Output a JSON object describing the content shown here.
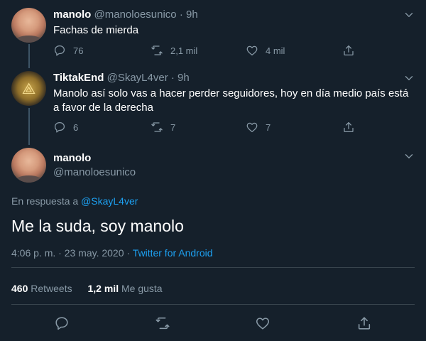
{
  "tweets": [
    {
      "name": "manolo",
      "handle": "@manoloesunico",
      "separator": "·",
      "time": "9h",
      "text": "Fachas de mierda",
      "replies": "76",
      "retweets": "2,1 mil",
      "likes": "4 mil"
    },
    {
      "name": "TiktakEnd",
      "handle": "@SkayL4ver",
      "separator": "·",
      "time": "9h",
      "text": "Manolo así solo vas a hacer perder seguidores, hoy en día medio país está a favor de la derecha",
      "replies": "6",
      "retweets": "7",
      "likes": "7"
    }
  ],
  "main": {
    "name": "manolo",
    "handle": "@manoloesunico",
    "reply_prefix": "En respuesta a",
    "reply_handle": "@SkayL4ver",
    "text": "Me la suda, soy manolo",
    "timestamp": "4:06 p. m. · 23 may. 2020 ·",
    "source": "Twitter for Android",
    "retweets_count": "460",
    "retweets_label": "Retweets",
    "likes_count": "1,2 mil",
    "likes_label": "Me gusta"
  },
  "colors": {
    "background": "#15202b",
    "muted": "#8899a6",
    "accent": "#1da1f2",
    "divider": "#38444d"
  },
  "icons": [
    "reply-icon",
    "retweet-icon",
    "like-icon",
    "share-icon",
    "chevron-down-icon"
  ]
}
